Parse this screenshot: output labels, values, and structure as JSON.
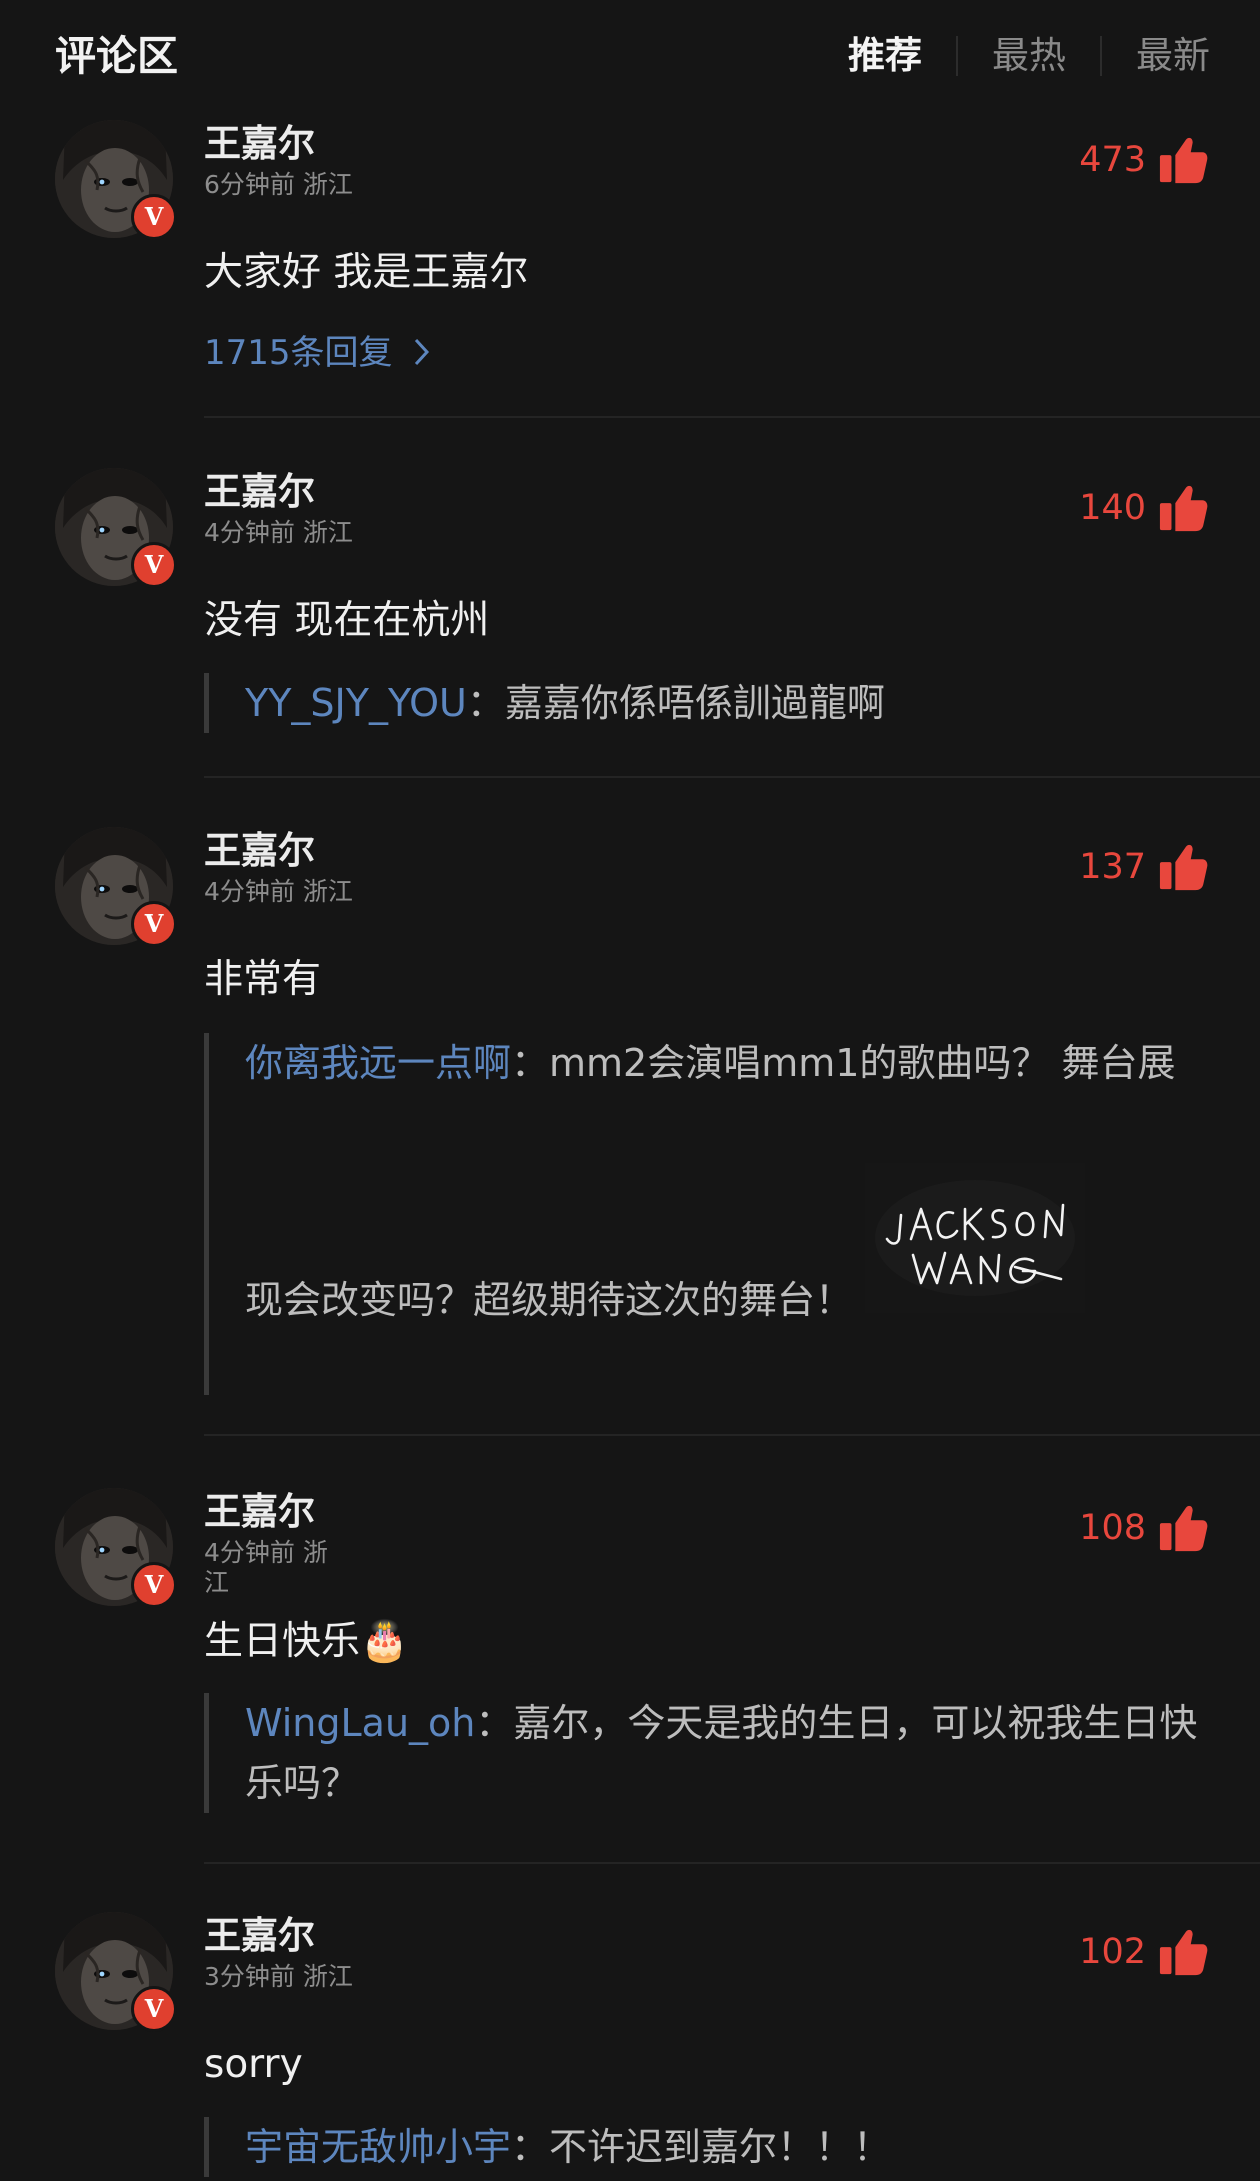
{
  "header": {
    "title": "评论区",
    "tabs": [
      {
        "label": "推荐",
        "active": true
      },
      {
        "label": "最热",
        "active": false
      },
      {
        "label": "最新",
        "active": false
      }
    ]
  },
  "colors": {
    "background": "#151515",
    "like": "#e8473d",
    "link": "#5d86be",
    "verified_badge": "#e0402f"
  },
  "icons": {
    "like": "thumbs-up-icon",
    "verified": "verified-v-icon",
    "reply_arrow": "chevron-right-icon"
  },
  "comments": [
    {
      "author": "王嘉尔",
      "badge": "V",
      "meta": "6分钟前 浙江",
      "likes": "473",
      "text": "大家好 我是王嘉尔",
      "replies": "1715条回复"
    },
    {
      "author": "王嘉尔",
      "badge": "V",
      "meta": "4分钟前 浙江",
      "likes": "140",
      "text": "没有 现在在杭州",
      "quote_user": "YY_SJY_YOU",
      "quote_text": "：嘉嘉你係唔係訓過龍啊"
    },
    {
      "author": "王嘉尔",
      "badge": "V",
      "meta": "4分钟前 浙江",
      "likes": "137",
      "text": "非常有",
      "quote_user": "你离我远一点啊",
      "quote_text": "：mm2会演唱mm1的歌曲吗？ 舞台展现会改变吗？超级期待这次的舞台！",
      "quote_image": "JACKSON WANG"
    },
    {
      "author": "王嘉尔",
      "badge": "V",
      "meta_line1": "4分钟前 浙",
      "meta_line2": "江",
      "likes": "108",
      "text": "生日快乐🎂",
      "quote_user": "WingLau_oh",
      "quote_text": "：嘉尔，今天是我的生日，可以祝我生日快乐吗？"
    },
    {
      "author": "王嘉尔",
      "badge": "V",
      "meta": "3分钟前 浙江",
      "likes": "102",
      "text": "sorry",
      "quote_user": "宇宙无敌帅小宇",
      "quote_text": "：不许迟到嘉尔！！！"
    }
  ]
}
